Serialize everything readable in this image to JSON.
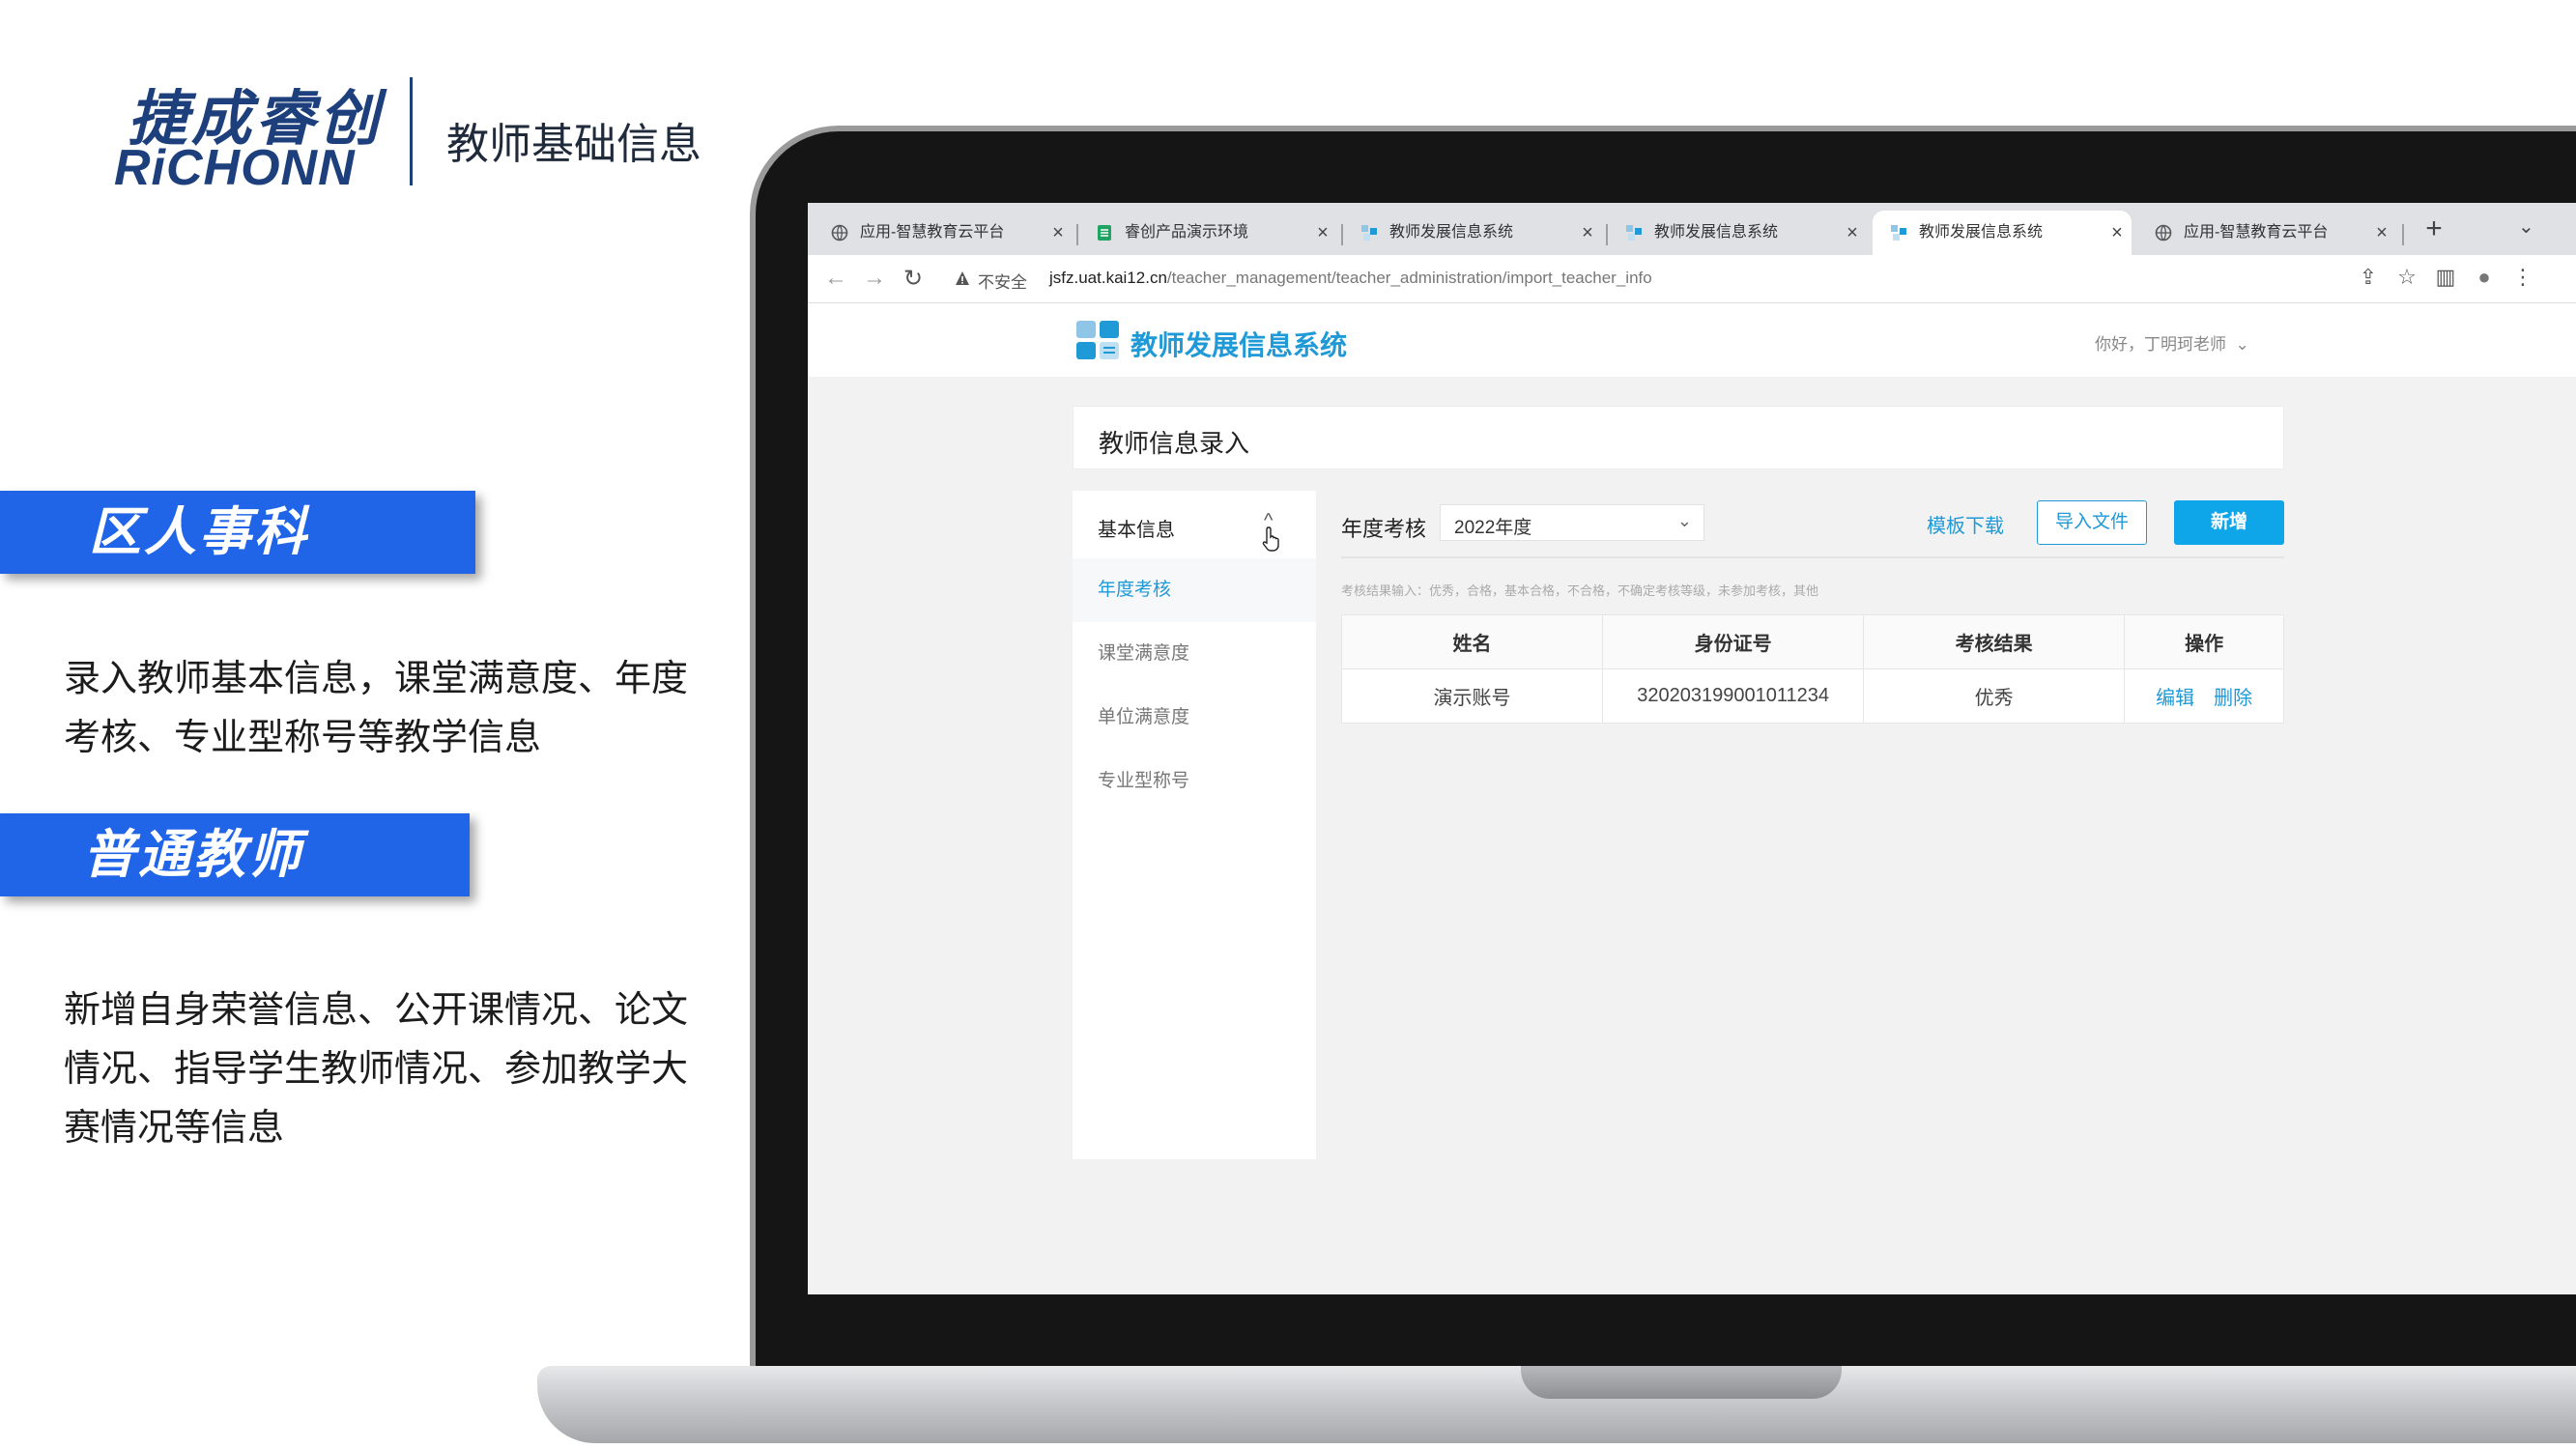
{
  "brand": {
    "name_cn": "捷成睿创",
    "name_en": "RiCHONN",
    "title": "教师基础信息"
  },
  "roles": [
    {
      "label": "区人事科",
      "description": "录入教师基本信息，课堂满意度、年度考核、专业型称号等教学信息"
    },
    {
      "label": "普通教师",
      "description": "新增自身荣誉信息、公开课情况、论文情况、指导学生教师情况、参加教学大赛情况等信息"
    }
  ],
  "browser": {
    "tabs": [
      {
        "title": "应用-智慧教育云平台",
        "icon": "globe-icon"
      },
      {
        "title": "睿创产品演示环境",
        "icon": "sheet-icon"
      },
      {
        "title": "教师发展信息系统",
        "icon": "app-icon"
      },
      {
        "title": "教师发展信息系统",
        "icon": "app-icon"
      },
      {
        "title": "教师发展信息系统",
        "icon": "app-icon"
      },
      {
        "title": "应用-智慧教育云平台",
        "icon": "globe-icon"
      }
    ],
    "active_tab": 4,
    "new_tab": "+",
    "tab_close": "×",
    "tab_menu": "⌄",
    "nav_back": "←",
    "nav_forward": "→",
    "nav_reload": "↻",
    "insecure_label": "不安全",
    "url_host": "jsfz.uat.kai12.cn",
    "url_path": "/teacher_management/teacher_administration/import_teacher_info",
    "toolbar_icons": [
      "share-icon",
      "star-icon",
      "sidebar-icon",
      "profile-icon",
      "more-icon"
    ],
    "toolbar_glyphs": [
      "⇪",
      "☆",
      "▥",
      "●",
      "⋮"
    ]
  },
  "app": {
    "title": "教师发展信息系统",
    "greeting": "你好，丁明珂老师",
    "greeting_arrow": "⌄",
    "page_title": "教师信息录入",
    "sidebar": {
      "group_label": "基本信息",
      "group_chevron": "^",
      "items": [
        {
          "label": "年度考核",
          "active": true
        },
        {
          "label": "课堂满意度",
          "active": false
        },
        {
          "label": "单位满意度",
          "active": false
        },
        {
          "label": "专业型称号",
          "active": false
        }
      ]
    },
    "filter": {
      "label": "年度考核",
      "selected": "2022年度",
      "arrow": "⌄"
    },
    "actions": {
      "template_download": "模板下载",
      "import_file": "导入文件",
      "add": "新增"
    },
    "hint": "考核结果输入：优秀，合格，基本合格，不合格，不确定考核等级，未参加考核，其他",
    "table": {
      "headers": [
        "姓名",
        "身份证号",
        "考核结果",
        "操作"
      ],
      "rows": [
        {
          "name": "演示账号",
          "id_number": "320203199001011234",
          "result": "优秀",
          "edit": "编辑",
          "delete": "删除"
        }
      ]
    }
  },
  "colors": {
    "brand_navy": "#1d3f7c",
    "banner_blue": "#2065e8",
    "app_accent": "#1f9ad6",
    "primary_button": "#0ea5e9"
  }
}
